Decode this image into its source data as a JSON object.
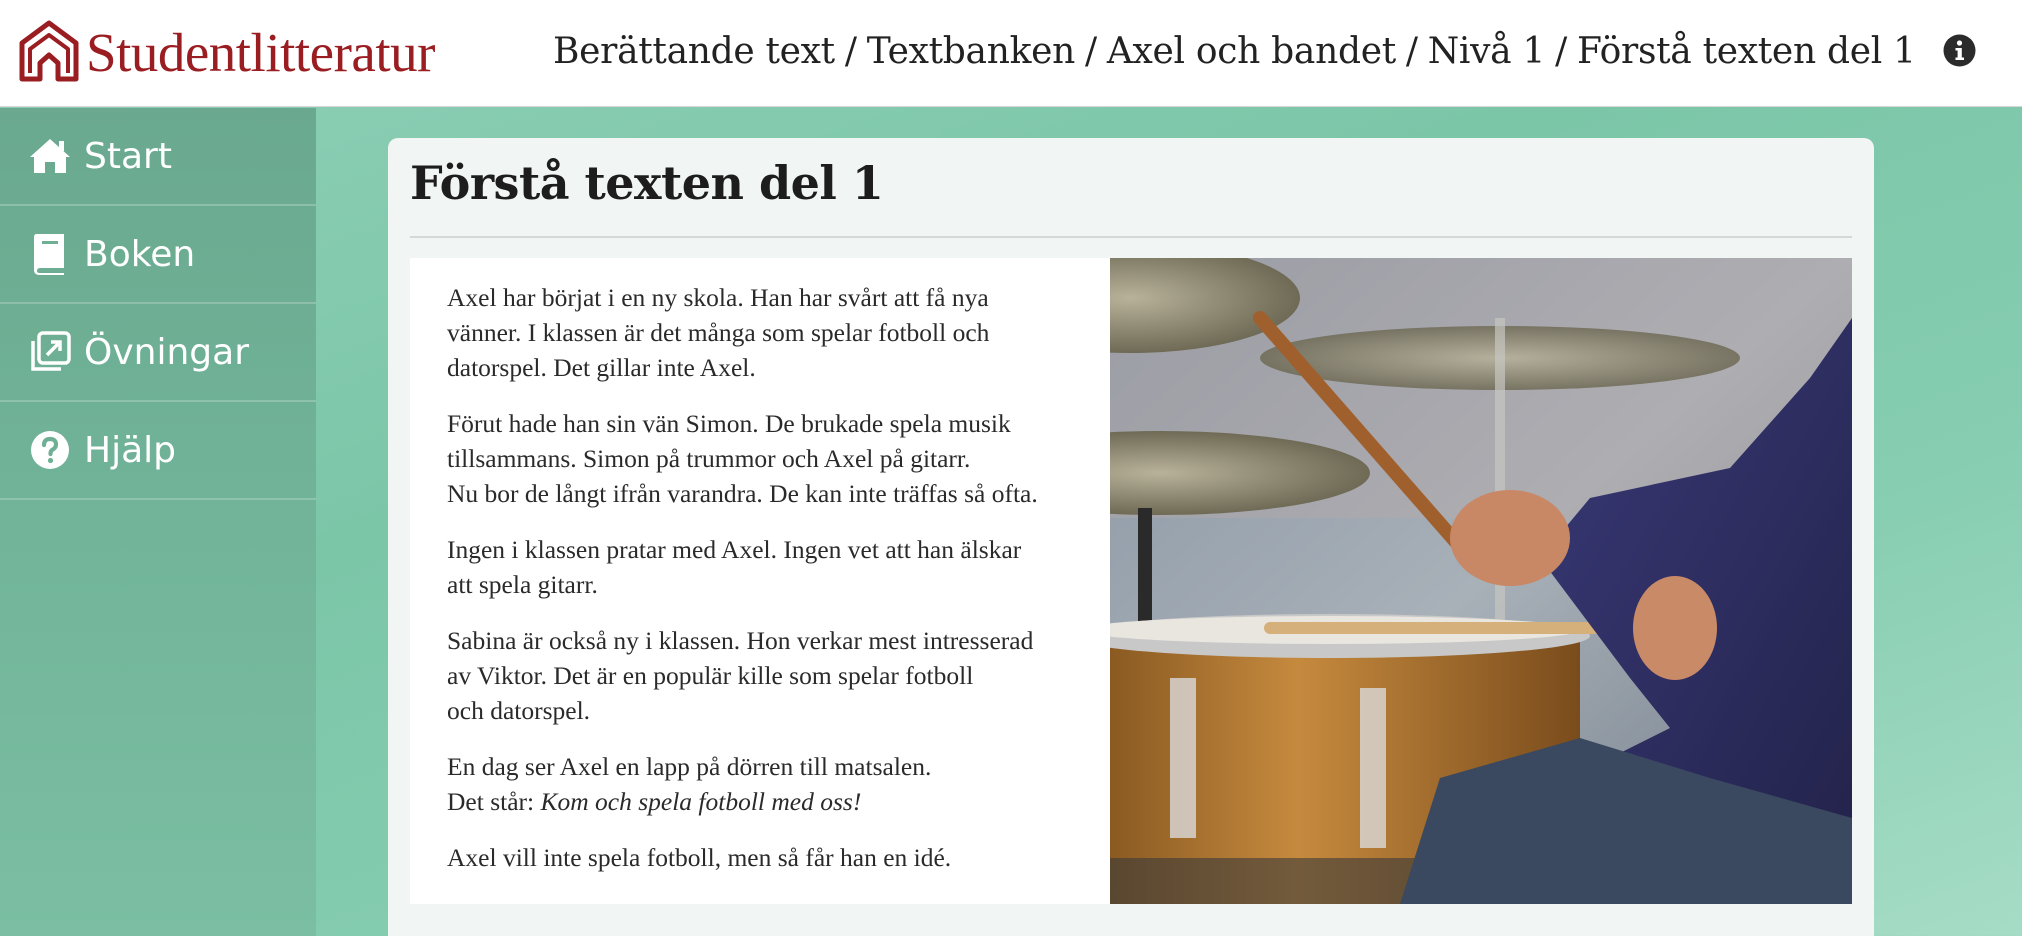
{
  "brand": {
    "name": "Studentlitteratur",
    "color": "#9a1d22"
  },
  "breadcrumb": [
    "Berättande text",
    "Textbanken",
    "Axel och bandet",
    "Nivå 1",
    "Förstå texten del 1"
  ],
  "breadcrumb_separator": "/",
  "header_icons": {
    "info": "info-icon"
  },
  "sidebar": {
    "items": [
      {
        "label": "Start",
        "icon": "home-icon"
      },
      {
        "label": "Boken",
        "icon": "book-icon"
      },
      {
        "label": "Övningar",
        "icon": "exercises-icon"
      },
      {
        "label": "Hjälp",
        "icon": "help-icon"
      }
    ]
  },
  "page": {
    "title": "Förstå texten del 1",
    "paragraphs": [
      "Axel har börjat i en ny skola. Han har svårt att få nya\nvänner. I klassen är det många som spelar fotboll och\ndatorspel. Det gillar inte Axel.",
      "Förut hade han sin vän Simon. De brukade spela musik\ntillsammans. Simon på trummor och Axel på gitarr.\nNu bor de långt ifrån varandra. De kan inte träffas så ofta.",
      "Ingen i klassen pratar med Axel. Ingen vet att han älskar\natt spela gitarr.",
      "Sabina är också ny i klassen. Hon verkar mest intresserad\nav Viktor. Det är en populär kille som spelar fotboll\noch datorspel.",
      "En dag ser Axel en lapp på dörren till matsalen."
    ],
    "para5_line2_prefix": "Det står: ",
    "para5_line2_italic": "Kom och spela fotboll med oss!",
    "last_paragraph": "Axel vill inte spela fotboll, men så får han en idé.",
    "image": "drummer-photo"
  }
}
